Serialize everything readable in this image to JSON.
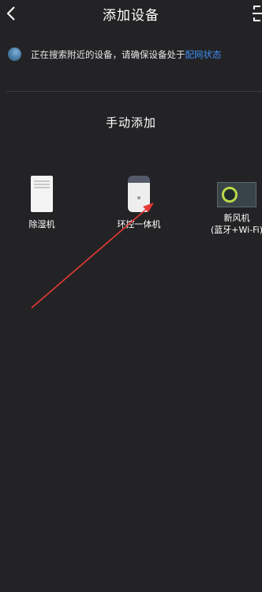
{
  "header": {
    "title": "添加设备"
  },
  "status": {
    "text": "正在搜索附近的设备，请确保设备处于",
    "link": "配网状态"
  },
  "manual": {
    "title": "手动添加",
    "devices": [
      {
        "label": "除湿机"
      },
      {
        "label": "环控一体机"
      },
      {
        "label": "新风机",
        "sublabel": "(蓝牙+Wi-Fi)"
      }
    ]
  },
  "colors": {
    "background": "#232325",
    "link": "#3d8bf0",
    "annotation": "#e53935"
  }
}
